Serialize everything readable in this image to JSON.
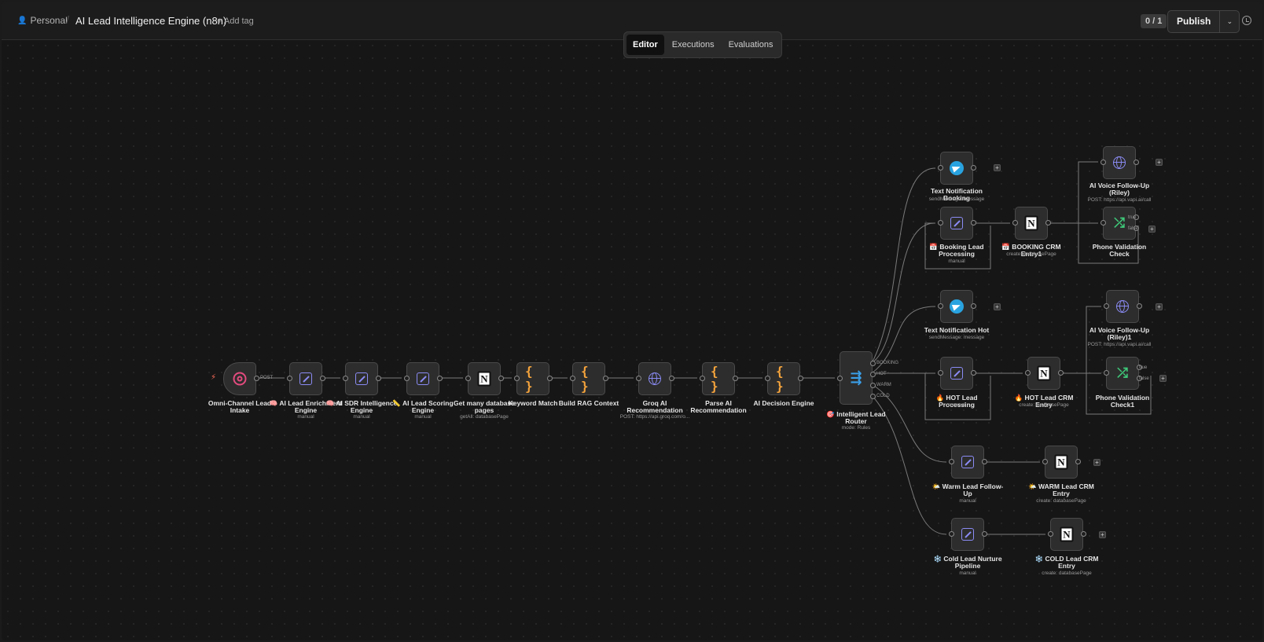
{
  "header": {
    "project": "Personal",
    "title": "AI Lead Intelligence Engine (n8n)",
    "add_tag": "+ Add tag",
    "counter": "0 / 1",
    "publish": "Publish"
  },
  "tabs": [
    "Editor",
    "Executions",
    "Evaluations"
  ],
  "edge_labels": {
    "post": "POST",
    "booking": "BOOKING",
    "hot": "HOT",
    "warm": "WARM",
    "cold": "COLD",
    "true": "true",
    "false": "false"
  },
  "nodes": {
    "intake": {
      "label": "Omni-Channel Lead Intake",
      "sub": ""
    },
    "enrich": {
      "label": "🧠 AI Lead Enrichment Engine",
      "sub": "manual"
    },
    "sdr": {
      "label": "🧠 AI SDR Intelligence Engine",
      "sub": "manual"
    },
    "scoring": {
      "label": "📏 AI Lead Scoring Engine",
      "sub": "manual"
    },
    "getmany": {
      "label": "Get many database pages",
      "sub": "getAll: databasePage"
    },
    "keyword": {
      "label": "Keyword Match",
      "sub": ""
    },
    "rag": {
      "label": "Build RAG Context",
      "sub": ""
    },
    "groq": {
      "label": "Groq AI Recommendation",
      "sub": "POST: https://api.groq.com/o..."
    },
    "parse": {
      "label": "Parse AI Recommendation",
      "sub": ""
    },
    "decision": {
      "label": "AI Decision Engine",
      "sub": ""
    },
    "router": {
      "label": "🎯 Intelligent Lead Router",
      "sub": "mode: Rules"
    },
    "tn_booking": {
      "label": "Text Notification Booking",
      "sub": "sendMessage: message"
    },
    "booking_proc": {
      "label": "📅 Booking Lead Processing",
      "sub": "manual"
    },
    "booking_crm": {
      "label": "📅 BOOKING CRM Entry1",
      "sub": "create: databasePage"
    },
    "voice_riley": {
      "label": "AI Voice Follow-Up (Riley)",
      "sub": "POST: https://api.vapi.ai/call"
    },
    "phone_check": {
      "label": "Phone Validation Check",
      "sub": ""
    },
    "tn_hot": {
      "label": "Text Notification Hot",
      "sub": "sendMessage: message"
    },
    "hot_proc": {
      "label": "🔥 HOT Lead Processing",
      "sub": "manual"
    },
    "hot_crm": {
      "label": "🔥 HOT Lead CRM Entry",
      "sub": "create: databasePage"
    },
    "voice_riley1": {
      "label": "AI Voice Follow-Up (Riley)1",
      "sub": "POST: https://api.vapi.ai/call"
    },
    "phone_check1": {
      "label": "Phone Validation Check1",
      "sub": ""
    },
    "warm_follow": {
      "label": "🌤️ Warm Lead Follow-Up",
      "sub": "manual"
    },
    "warm_crm": {
      "label": "🌤️ WARM Lead CRM Entry",
      "sub": "create: databasePage"
    },
    "cold_nurture": {
      "label": "❄️ Cold Lead Nurture Pipeline",
      "sub": "manual"
    },
    "cold_crm": {
      "label": "❄️ COLD Lead CRM Entry",
      "sub": "create: databasePage"
    }
  }
}
